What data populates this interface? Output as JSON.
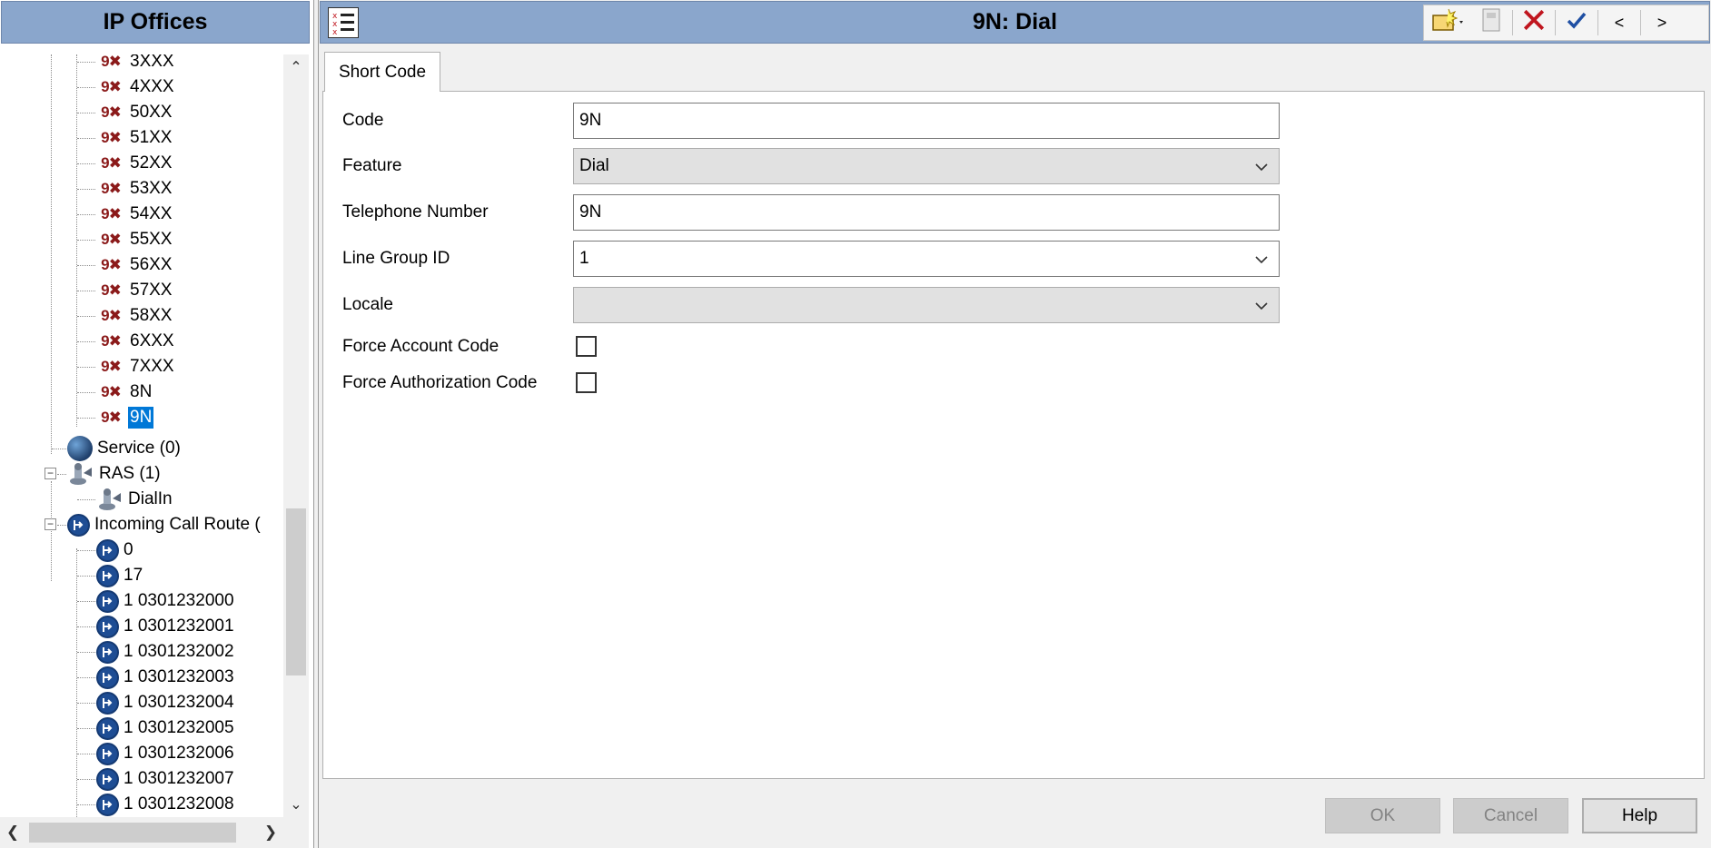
{
  "left_pane": {
    "title": "IP Offices",
    "short_codes": [
      "3XXX",
      "4XXX",
      "50XX",
      "51XX",
      "52XX",
      "53XX",
      "54XX",
      "55XX",
      "56XX",
      "57XX",
      "58XX",
      "6XXX",
      "7XXX",
      "8N",
      "9N"
    ],
    "short_code_icon_text": "9✖",
    "selected": "9N",
    "service": "Service (0)",
    "ras": "RAS (1)",
    "ras_child": "DialIn",
    "incoming_call_route": "Incoming Call Route (",
    "routes": [
      "0",
      "17",
      "1 0301232000",
      "1 0301232001",
      "1 0301232002",
      "1 0301232003",
      "1 0301232004",
      "1 0301232005",
      "1 0301232006",
      "1 0301232007",
      "1 0301232008"
    ],
    "expander_collapse_symbol": "−"
  },
  "window": {
    "title": "9N: Dial"
  },
  "tabs": [
    {
      "label": "Short Code"
    }
  ],
  "form": {
    "code_label": "Code",
    "code_value": "9N",
    "feature_label": "Feature",
    "feature_value": "Dial",
    "telephone_label": "Telephone Number",
    "telephone_value": "9N",
    "line_group_label": "Line Group ID",
    "line_group_value": "1",
    "locale_label": "Locale",
    "locale_value": "",
    "force_account_label": "Force Account Code",
    "force_account_checked": false,
    "force_auth_label": "Force Authorization Code",
    "force_auth_checked": false
  },
  "buttons": {
    "ok": "OK",
    "cancel": "Cancel",
    "help": "Help"
  },
  "scroll_glyphs": {
    "up": "⌃",
    "down": "⌄",
    "left": "❮",
    "right": "❯"
  },
  "toolbar": {
    "prev": "<",
    "next": ">"
  },
  "colors": {
    "header_blue": "#8aa6cc",
    "selection_blue": "#0078d7",
    "short_code_red": "#8b1a1a",
    "route_blue": "#1e4d94",
    "delete_red": "#c0161f",
    "check_blue": "#1f4fa3"
  },
  "icons": {
    "short_code": "short-code-icon",
    "route": "incoming-route-icon",
    "service": "service-globe-icon",
    "ras": "ras-icon",
    "new": "new-icon",
    "export": "export-icon",
    "delete": "delete-icon",
    "validate": "checkmark-icon"
  }
}
